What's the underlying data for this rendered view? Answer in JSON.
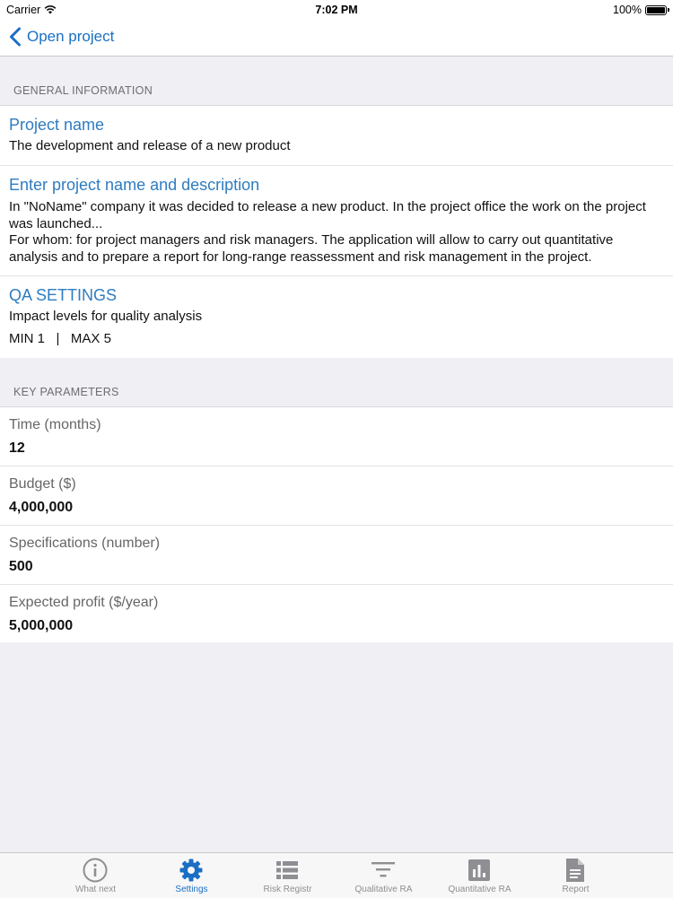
{
  "status": {
    "carrier": "Carrier",
    "time": "7:02 PM",
    "battery": "100%"
  },
  "nav": {
    "back_label": "Open project"
  },
  "general": {
    "header": "GENERAL INFORMATION",
    "project_name_title": "Project name",
    "project_name_value": "The development and release of a new product",
    "description_title": "Enter project name and description",
    "description_line1": "In \"NoName\" company  it was decided to release a new product. In the project office the work on the project was launched...",
    "description_line2": "For whom: for project managers and risk managers. The application will allow to carry out quantitative analysis and to prepare a report for long-range reassessment and risk management in the project.",
    "qa_title": "QA SETTINGS",
    "qa_subtitle": "Impact levels for quality analysis",
    "qa_range": "MIN 1   |   MAX 5"
  },
  "key_parameters": {
    "header": "KEY PARAMETERS",
    "items": [
      {
        "label": "Time (months)",
        "value": "12"
      },
      {
        "label": "Budget ($)",
        "value": "4,000,000"
      },
      {
        "label": "Specifications (number)",
        "value": "500"
      },
      {
        "label": "Expected profit ($/year)",
        "value": "5,000,000"
      }
    ]
  },
  "tabs": [
    {
      "label": "What next",
      "icon": "info-icon"
    },
    {
      "label": "Settings",
      "icon": "gear-icon",
      "active": true
    },
    {
      "label": "Risk Registr",
      "icon": "list-icon"
    },
    {
      "label": "Qualitative RA",
      "icon": "filter-icon"
    },
    {
      "label": "Quantitative RA",
      "icon": "bar-chart-icon"
    },
    {
      "label": "Report",
      "icon": "document-icon"
    }
  ],
  "colors": {
    "accent": "#1a6fc4",
    "section_title": "#2e7cc1",
    "background": "#efeff4",
    "inactive_icon": "#8e8e93"
  }
}
